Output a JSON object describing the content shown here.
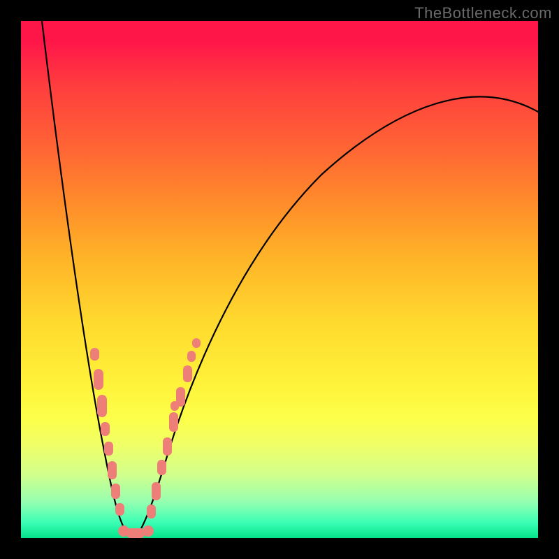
{
  "watermark": "TheBottleneck.com",
  "chart_data": {
    "type": "line",
    "title": "",
    "xlabel": "",
    "ylabel": "",
    "xlim": [
      0,
      100
    ],
    "ylim": [
      0,
      100
    ],
    "curve": {
      "vertex_x": 21,
      "left_start": {
        "x": 4,
        "y": 100
      },
      "right_end": {
        "x": 100,
        "y": 82
      },
      "description": "V-shaped bottleneck curve; minimum (best/green) near x≈21, rising steeply on both sides toward red."
    },
    "markers": {
      "color": "#ed7f78",
      "shape": "rounded-capsule",
      "points_left_branch_y_pct": [
        4,
        11,
        16,
        19,
        23,
        25,
        29,
        32,
        34,
        36
      ],
      "points_right_branch_y_pct": [
        3,
        5,
        9,
        14,
        20,
        24,
        27,
        30,
        33,
        36,
        38
      ],
      "points_bottom_x_pct": [
        18,
        20,
        22,
        24
      ]
    },
    "gradient_stops": [
      {
        "pct": 0,
        "color": "#ff1649"
      },
      {
        "pct": 50,
        "color": "#ffd92e"
      },
      {
        "pct": 80,
        "color": "#fcff4a"
      },
      {
        "pct": 100,
        "color": "#04e38b"
      }
    ]
  }
}
